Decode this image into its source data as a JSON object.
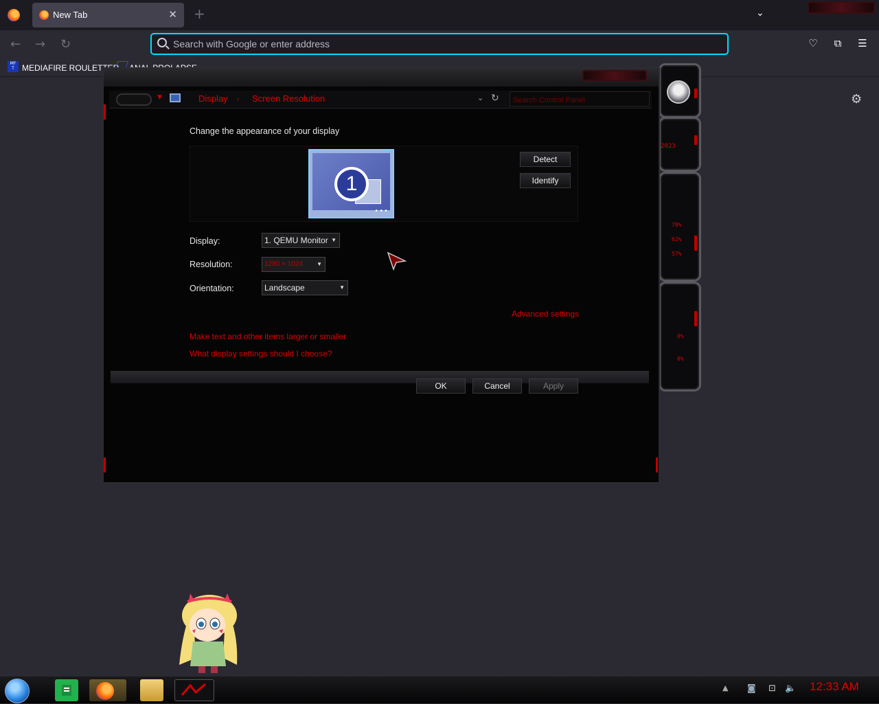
{
  "browser": {
    "tab_title": "New Tab",
    "url_placeholder": "Search with Google or enter address",
    "bookmarks": [
      {
        "label": "MEDIAFIRE ROULETTER",
        "icon": "mediafire-favicon"
      },
      {
        "label": "ANAL PROLAPSE",
        "icon": "bookmark-favicon"
      }
    ],
    "accent": "#00ddff"
  },
  "control_panel": {
    "breadcrumb": [
      "Display",
      "Screen Resolution"
    ],
    "search_placeholder": "Search Control Panel",
    "heading": "Change the appearance of your display",
    "monitor_number": "1",
    "detect_label": "Detect",
    "identify_label": "Identify",
    "display_label": "Display:",
    "display_value": "1. QEMU Monitor",
    "resolution_label": "Resolution:",
    "resolution_value": "1280 × 1024",
    "orientation_label": "Orientation:",
    "orientation_value": "Landscape",
    "advanced_link": "Advanced settings",
    "text_size_link": "Make text and other items larger or smaller",
    "help_link": "What display settings should I choose?",
    "ok_label": "OK",
    "cancel_label": "Cancel",
    "apply_label": "Apply",
    "theme_red": "#e00000"
  },
  "gadget": {
    "readouts": [
      "78%",
      "62%",
      "57%",
      "0%",
      "0%"
    ],
    "date_text": "2023"
  },
  "taskbar": {
    "clock": "12:33 AM",
    "apps": [
      "sticky-notes-icon",
      "firefox-icon",
      "file-explorer-icon",
      "alienware-app-icon"
    ]
  }
}
